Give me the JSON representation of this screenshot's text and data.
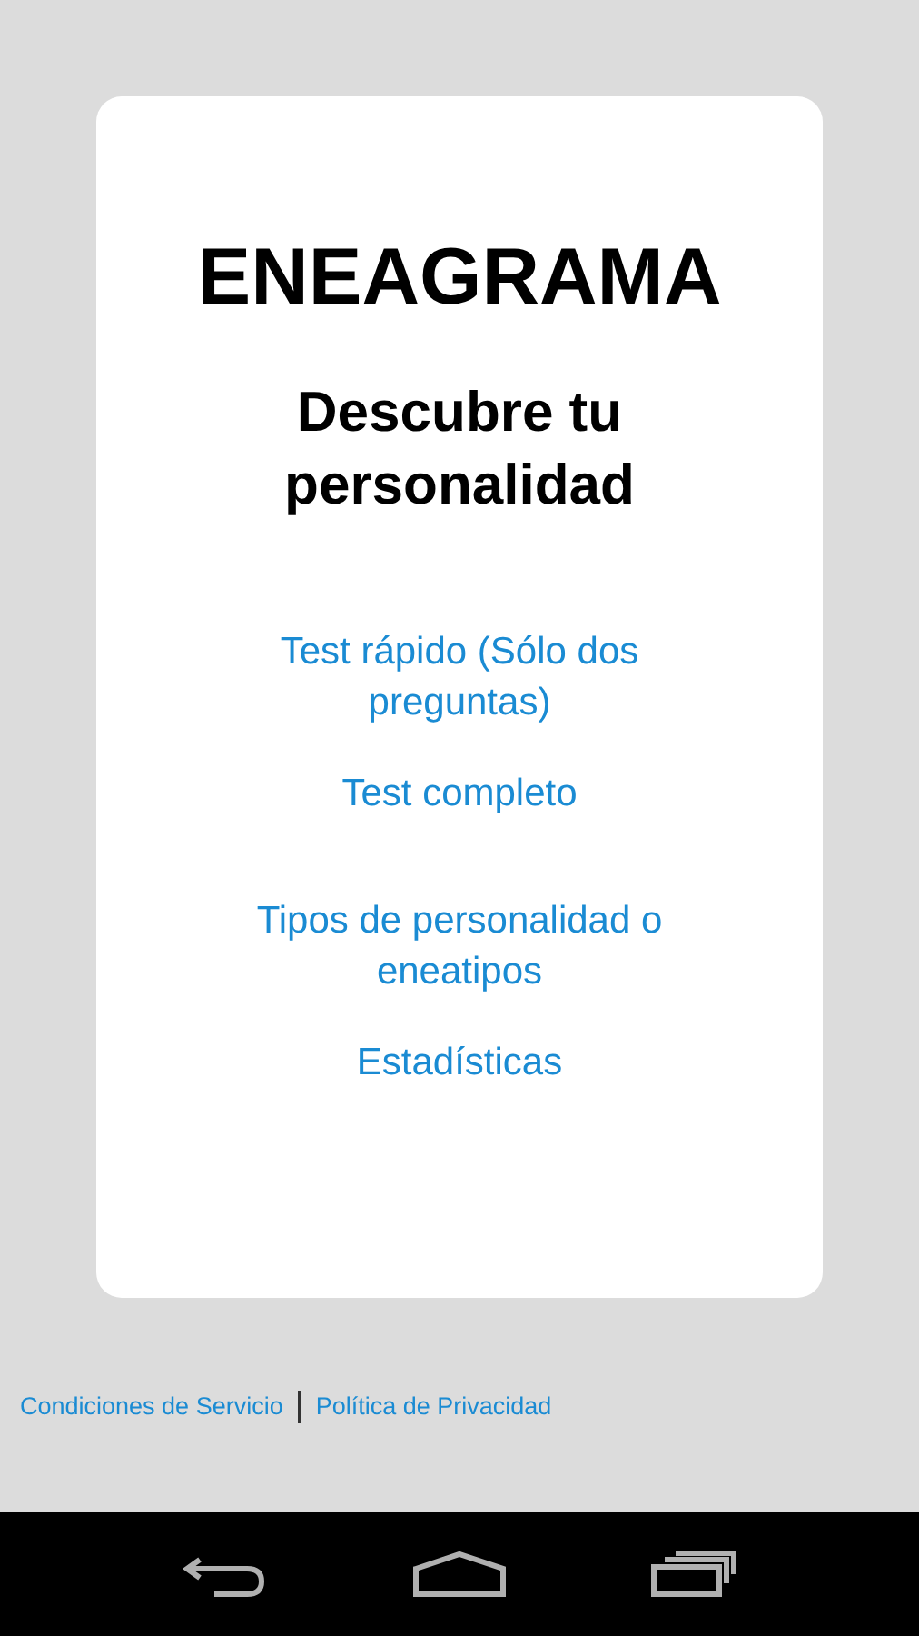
{
  "card": {
    "title": "ENEAGRAMA",
    "subtitle": "Descubre tu personalidad",
    "links": [
      {
        "label": "Test rápido (Sólo dos preguntas)"
      },
      {
        "label": "Test completo"
      },
      {
        "label": "Tipos de personalidad o eneatipos"
      },
      {
        "label": "Estadísticas"
      }
    ]
  },
  "footer_links": [
    {
      "label": "Condiciones de Servicio"
    },
    {
      "label": "Política de Privacidad"
    }
  ]
}
